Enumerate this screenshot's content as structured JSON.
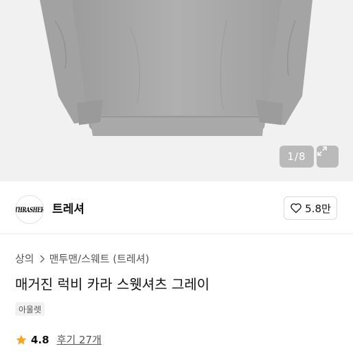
{
  "product": {
    "image_pager": "1/8",
    "brand": {
      "logo_text": "THRASHER",
      "name": "트레셔"
    },
    "likes": "5.8만",
    "breadcrumb": [
      "상의",
      "맨투맨/스웨트 (트레셔)"
    ],
    "title": "매거진 럭비 카라 스웻셔츠 그레이",
    "tag": "아울렛",
    "rating": "4.8",
    "reviews": "후기 27개"
  },
  "colors": {
    "star": "#f5a623",
    "shirt": "#a8a8a8",
    "background": "#f1f1f1"
  },
  "icons": [
    "expand-icon",
    "heart-icon",
    "chevron-right-icon",
    "star-icon"
  ]
}
